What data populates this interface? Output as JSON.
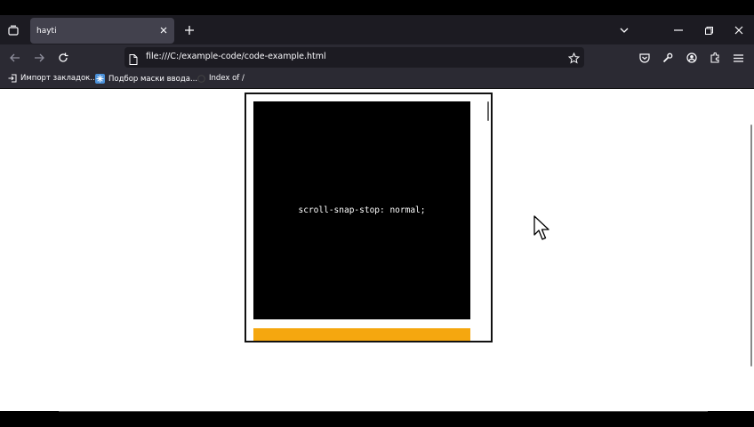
{
  "browser": {
    "tab": {
      "title": "hayti"
    },
    "url": "file:///C:/example-code/code-example.html",
    "bookmarks": [
      {
        "label": "Импорт закладок..."
      },
      {
        "label": "Подбор маски ввода..."
      },
      {
        "label": "Index of /"
      }
    ]
  },
  "page": {
    "demo_text": "scroll-snap-stop: normal;",
    "colors": {
      "panel_primary": "#000000",
      "panel_secondary": "#f5a70f"
    }
  }
}
